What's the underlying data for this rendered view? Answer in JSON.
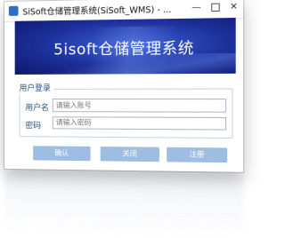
{
  "window": {
    "title": "SiSoft仓储管理系统(SiSoft_WMS) - ...",
    "minimize": "—",
    "close": "✕"
  },
  "banner": {
    "title": "5isoft仓储管理系统"
  },
  "login": {
    "group_title": "用户登录",
    "username_label": "用户名",
    "username_placeholder": "请输入账号",
    "password_label": "密码",
    "password_placeholder": "请输入密码"
  },
  "buttons": {
    "confirm": "确认",
    "close": "关闭",
    "register": "注册"
  },
  "colors": {
    "banner": "#1c2f9a",
    "button": "#9dbde2",
    "label": "#2b4f86"
  }
}
